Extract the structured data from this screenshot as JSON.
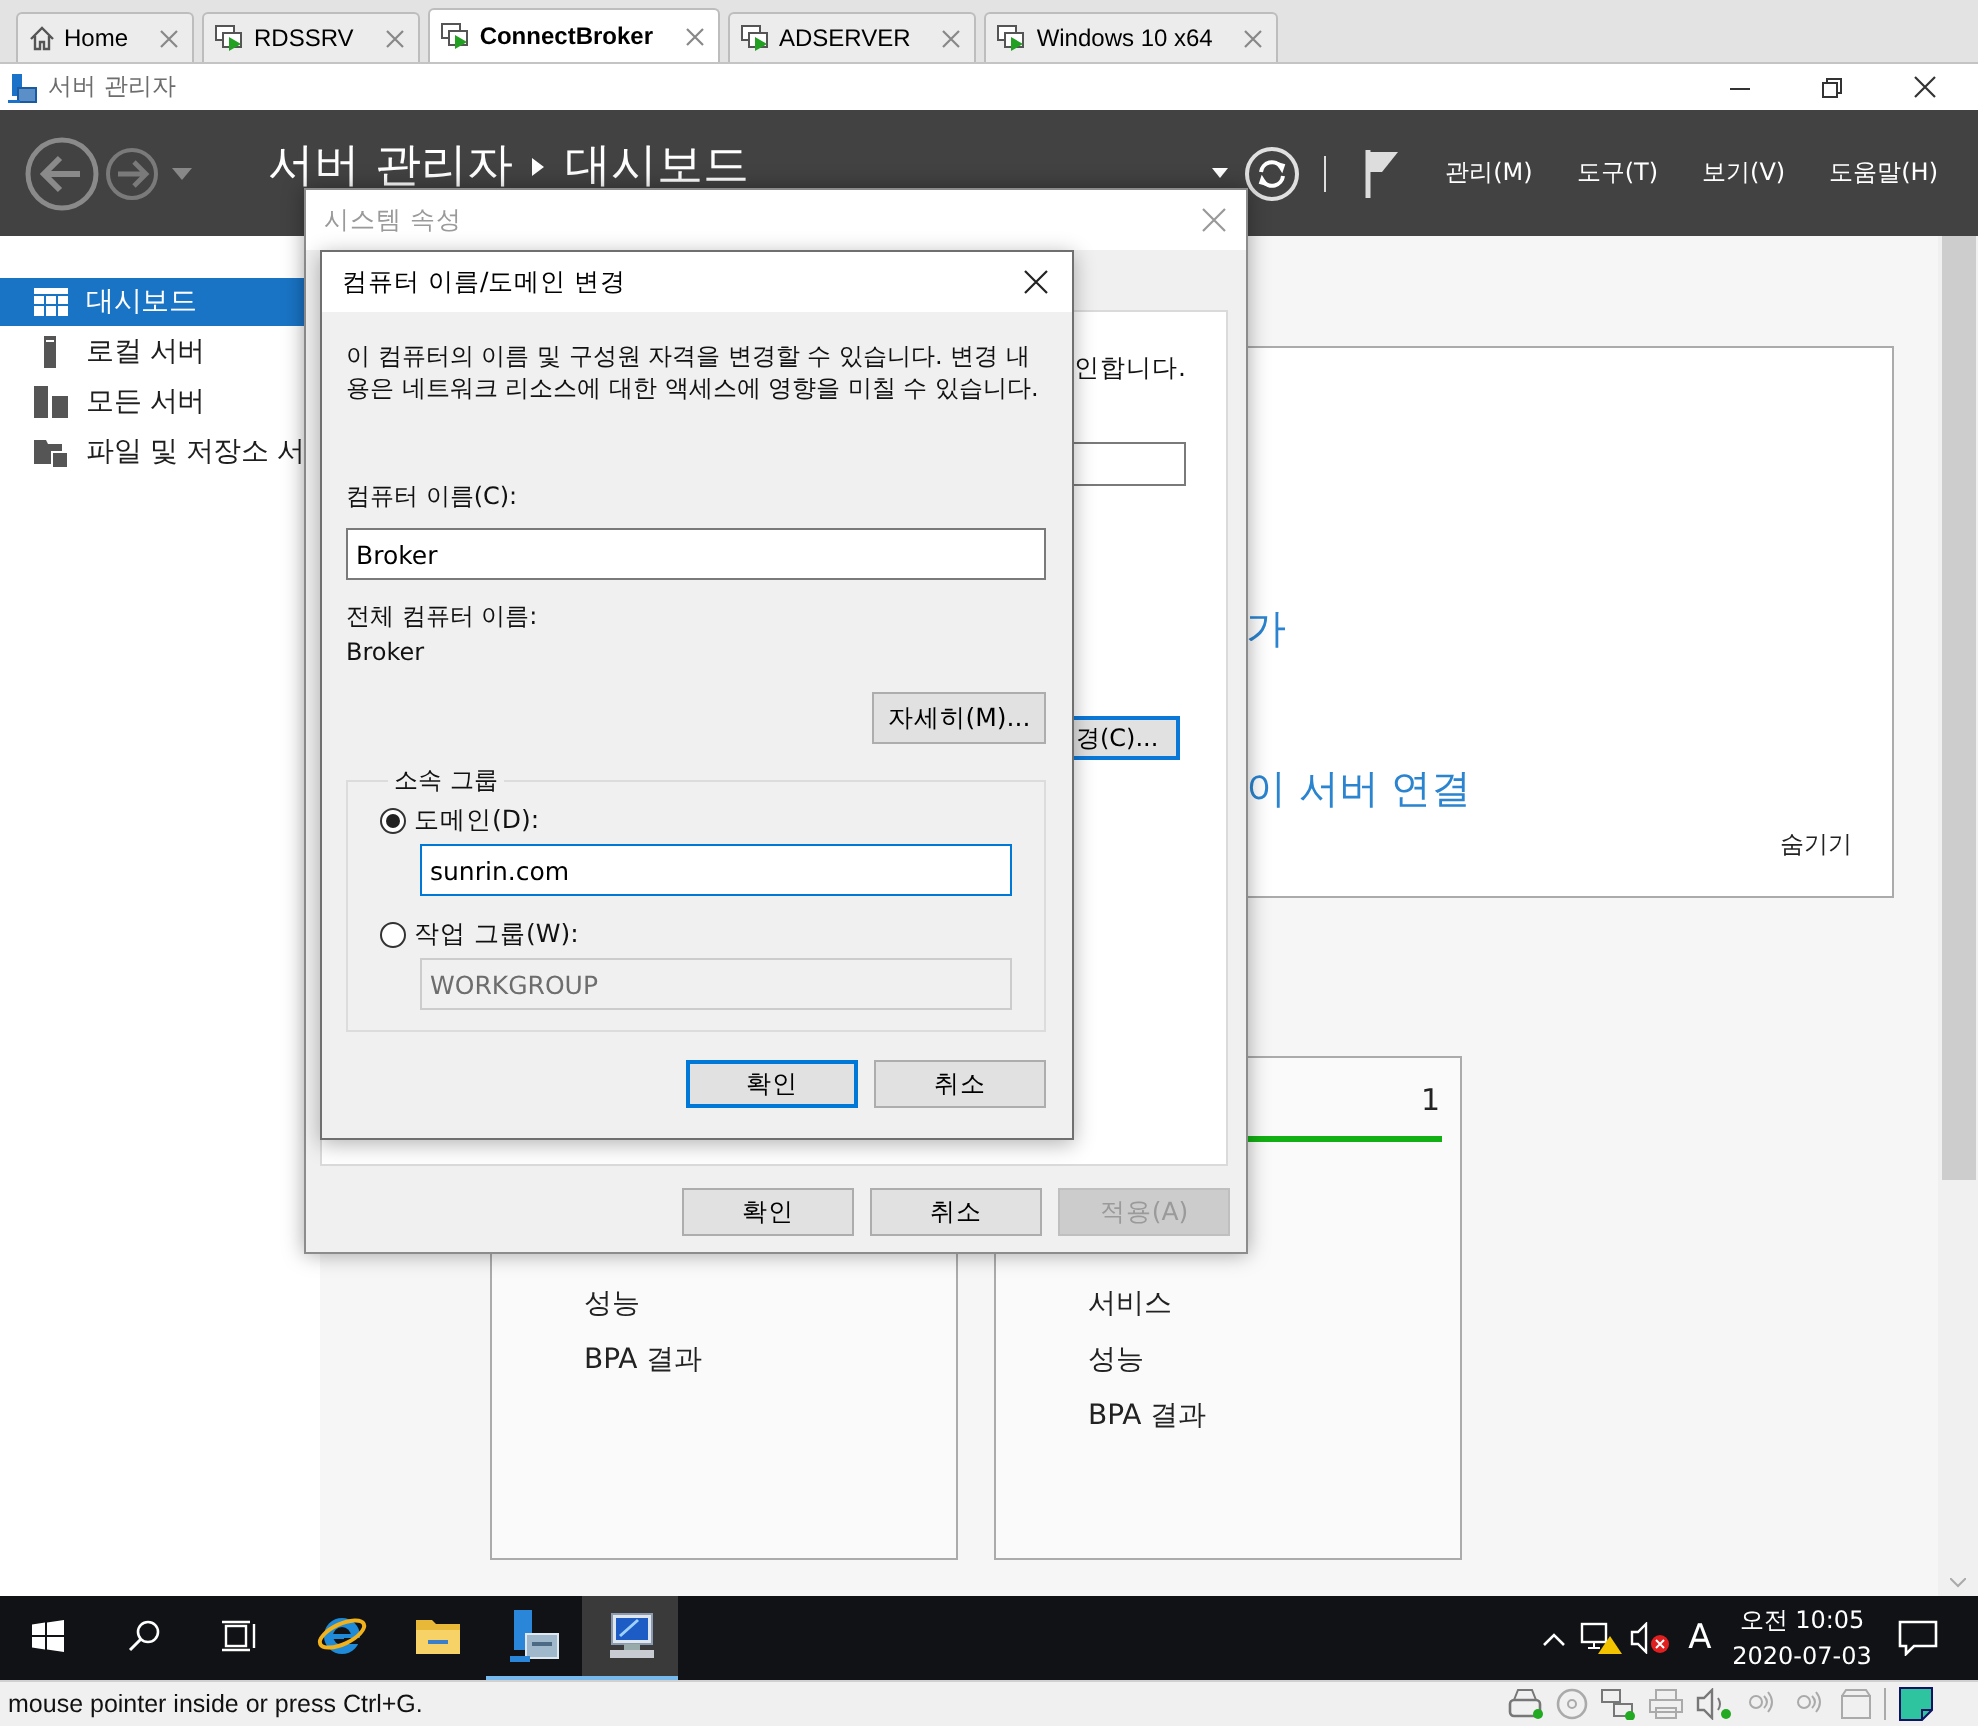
{
  "vm_tabs": [
    {
      "label": "Home",
      "kind": "home",
      "selected": false
    },
    {
      "label": "RDSSRV",
      "kind": "vm",
      "selected": false
    },
    {
      "label": "ConnectBroker",
      "kind": "vm",
      "selected": true
    },
    {
      "label": "ADSERVER",
      "kind": "vm",
      "selected": false
    },
    {
      "label": "Windows 10 x64",
      "kind": "vm",
      "selected": false
    }
  ],
  "window": {
    "title": "서버 관리자"
  },
  "header": {
    "breadcrumb": [
      "서버 관리자",
      "대시보드"
    ],
    "menus": [
      "관리(M)",
      "도구(T)",
      "보기(V)",
      "도움말(H)"
    ]
  },
  "sidebar": {
    "items": [
      {
        "label": "대시보드",
        "kind": "dashboard",
        "selected": true
      },
      {
        "label": "로컬 서버",
        "kind": "local",
        "selected": false
      },
      {
        "label": "모든 서버",
        "kind": "all",
        "selected": false
      },
      {
        "label": "파일 및 저장소 서",
        "kind": "files",
        "selected": false
      }
    ]
  },
  "welcome_panel": {
    "links": [
      "가",
      "이 서버 연결"
    ],
    "hide": "숨기기"
  },
  "tiles": [
    {
      "items": [
        "성능",
        "BPA 결과"
      ]
    },
    {
      "count": "1",
      "items": [
        "서비스",
        "성능",
        "BPA 결과"
      ]
    }
  ],
  "system_properties": {
    "title": "시스템 속성",
    "partial_text": "인합니다.",
    "partial_button": "경(C)...",
    "buttons": [
      {
        "label": "확인",
        "disabled": false
      },
      {
        "label": "취소",
        "disabled": false
      },
      {
        "label": "적용(A)",
        "disabled": true
      }
    ]
  },
  "name_dialog": {
    "title": "컴퓨터 이름/도메인 변경",
    "description": "이 컴퓨터의 이름 및 구성원 자격을 변경할 수 있습니다. 변경 내용은 네트워크 리소스에 대한 액세스에 영향을 미칠 수 있습니다.",
    "computer_name_label": "컴퓨터 이름(C):",
    "computer_name": "Broker",
    "full_name_label": "전체 컴퓨터 이름:",
    "full_name": "Broker",
    "more_button": "자세히(M)...",
    "member_of": {
      "legend": "소속 그룹",
      "options": [
        {
          "label": "도메인(D):",
          "selected": true,
          "value": "sunrin.com"
        },
        {
          "label": "작업 그룹(W):",
          "selected": false,
          "value": "WORKGROUP"
        }
      ]
    },
    "buttons": [
      {
        "label": "확인",
        "default": true
      },
      {
        "label": "취소",
        "default": false
      }
    ]
  },
  "taskbar": {
    "buttons": [
      {
        "kind": "start"
      },
      {
        "kind": "search"
      },
      {
        "kind": "task_view"
      }
    ],
    "apps": [
      {
        "kind": "browser",
        "running": false,
        "selected": false
      },
      {
        "kind": "folder",
        "running": false,
        "selected": false
      },
      {
        "kind": "server_manager",
        "running": true,
        "selected": false
      },
      {
        "kind": "computer",
        "running": true,
        "selected": true
      }
    ],
    "tray": {
      "input_mode": "A",
      "time": "오전 10:05",
      "date": "2020-07-03"
    }
  },
  "status_bar": {
    "text": "mouse pointer inside or press Ctrl+G."
  }
}
